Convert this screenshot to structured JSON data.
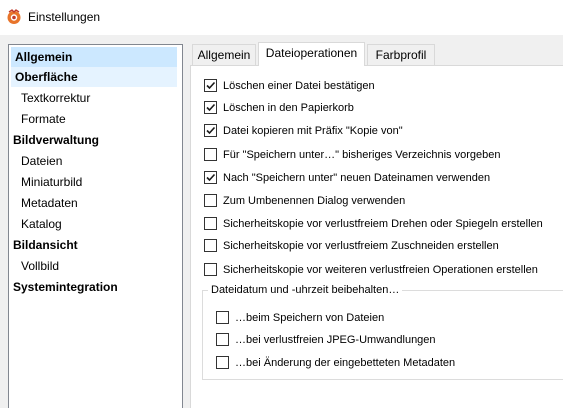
{
  "window": {
    "title": "Einstellungen"
  },
  "sidebar": {
    "items": [
      {
        "label": "Allgemein"
      },
      {
        "label": "Oberfläche"
      },
      {
        "label": "Textkorrektur"
      },
      {
        "label": "Formate"
      },
      {
        "label": "Bildverwaltung"
      },
      {
        "label": "Dateien"
      },
      {
        "label": "Miniaturbild"
      },
      {
        "label": "Metadaten"
      },
      {
        "label": "Katalog"
      },
      {
        "label": "Bildansicht"
      },
      {
        "label": "Vollbild"
      },
      {
        "label": "Systemintegration"
      }
    ]
  },
  "tabs": [
    {
      "label": "Allgemein"
    },
    {
      "label": "Dateioperationen",
      "active": true
    },
    {
      "label": "Farbprofil"
    }
  ],
  "options": [
    {
      "label": "Löschen einer Datei bestätigen",
      "checked": true
    },
    {
      "label": "Löschen in den Papierkorb",
      "checked": true
    },
    {
      "label": "Datei kopieren mit Präfix \"Kopie von\"",
      "checked": true
    },
    {
      "label": "Für \"Speichern unter…\" bisheriges Verzeichnis vorgeben",
      "checked": false
    },
    {
      "label": "Nach \"Speichern unter\" neuen Dateinamen verwenden",
      "checked": true
    },
    {
      "label": "Zum Umbenennen Dialog verwenden",
      "checked": false
    },
    {
      "label": "Sicherheitskopie vor verlustfreiem Drehen oder Spiegeln erstellen",
      "checked": false
    },
    {
      "label": "Sicherheitskopie vor verlustfreiem Zuschneiden erstellen",
      "checked": false
    },
    {
      "label": "Sicherheitskopie vor weiteren verlustfreien Operationen erstellen",
      "checked": false
    }
  ],
  "group": {
    "title": "Dateidatum und -uhrzeit beibehalten…",
    "options": [
      {
        "label": "…beim  Speichern von Dateien",
        "checked": false
      },
      {
        "label": "…bei verlustfreien JPEG-Umwandlungen",
        "checked": false
      },
      {
        "label": "…bei Änderung der eingebetteten Metadaten",
        "checked": false
      }
    ]
  },
  "colors": {
    "selection": "#cce8ff",
    "hover": "#e5f3ff",
    "window_bg": "#f0f0f0"
  }
}
